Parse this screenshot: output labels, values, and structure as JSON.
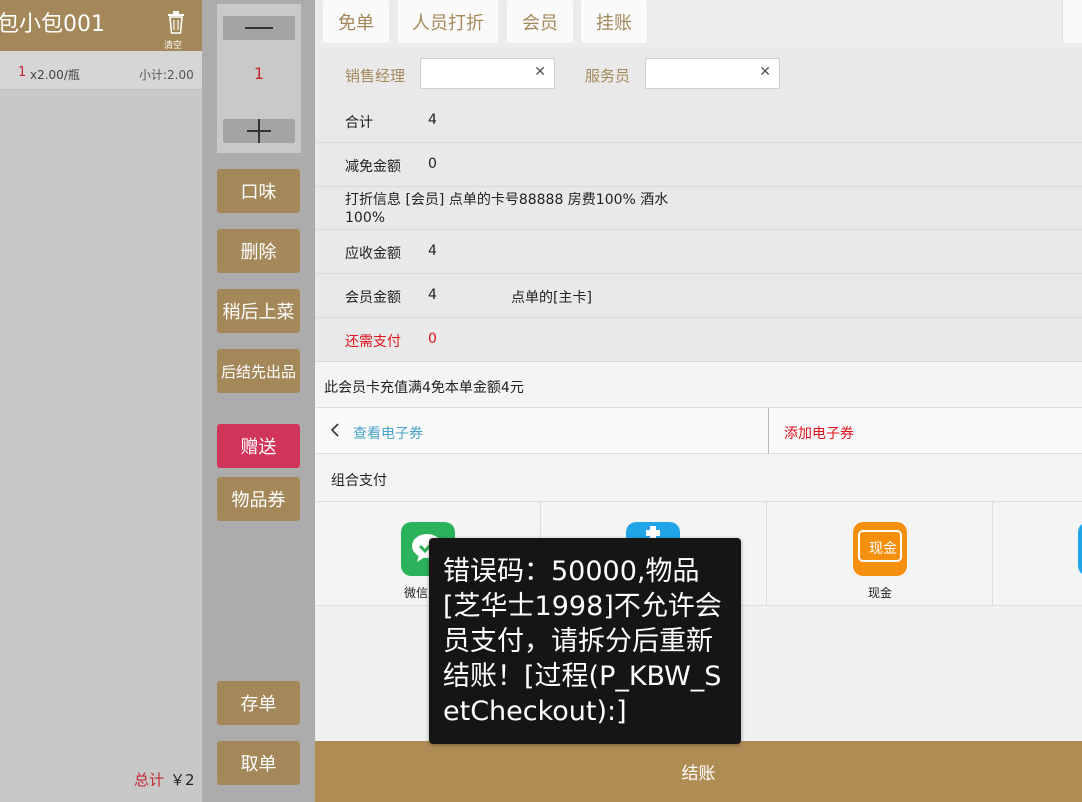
{
  "order": {
    "room_title": "包小包001",
    "clear_label": "清空",
    "items": [
      {
        "qty": "1",
        "price": "x2.00/瓶",
        "subtotal": "小计:2.00"
      }
    ],
    "total_label": "总计",
    "total_value": "￥2"
  },
  "actions": {
    "quantity": "1",
    "flavor": "口味",
    "delete": "删除",
    "serve_later": "稍后上菜",
    "settle_first": "后结先出品",
    "gift": "赠送",
    "voucher": "物品券",
    "save_order": "存单",
    "retrieve_order": "取单"
  },
  "tabs": [
    "免单",
    "人员打折",
    "会员",
    "挂账"
  ],
  "staff": {
    "sales_manager_label": "销售经理",
    "sales_manager_value": "",
    "waiter_label": "服务员",
    "waiter_value": ""
  },
  "summary": {
    "total_label": "合计",
    "total_value": "4",
    "waived_label": "减免金额",
    "waived_value": "0",
    "discount_info": "打折信息  [会员] 点单的卡号88888 房费100% 酒水100%",
    "receivable_label": "应收金额",
    "receivable_value": "4",
    "member_label": "会员金额",
    "member_value": "4",
    "member_card": "点单的[主卡]",
    "due_label": "还需支付",
    "due_value": "0"
  },
  "notice": "此会员卡充值满4免本单金额4元",
  "coupons": {
    "view_label": "查看电子券",
    "add_label": "添加电子券"
  },
  "combined_payment_label": "组合支付",
  "payment_methods": [
    {
      "label": "微信支付",
      "icon": "wechat-icon",
      "color": "#2ab35a"
    },
    {
      "label": "",
      "icon": "plus-card-icon",
      "color": "#20a6e8"
    },
    {
      "label": "现金",
      "icon": "cash-icon",
      "color": "#f5900f",
      "icon_text": "现金"
    },
    {
      "label": "",
      "icon": "card-icon",
      "color": "#20a6e8"
    }
  ],
  "checkout_label": "结账",
  "toast": {
    "message": "错误码：50000,物品[芝华士1998]不允许会员支付，请拆分后重新结账！[过程(P_KBW_SetCheckout):]"
  }
}
